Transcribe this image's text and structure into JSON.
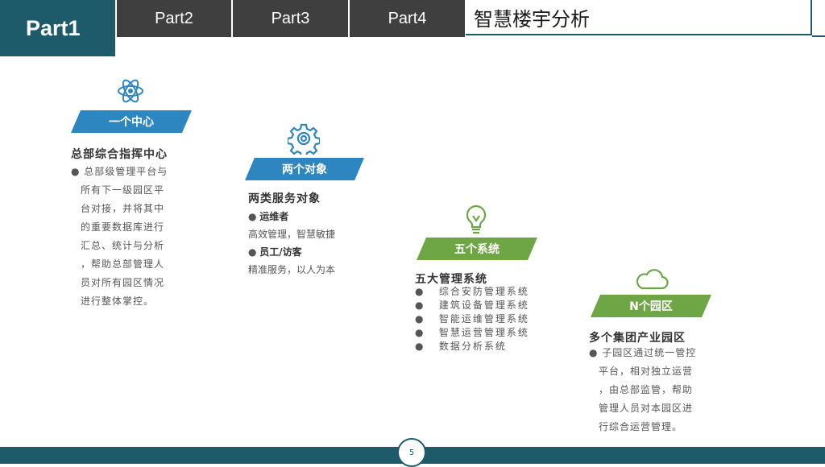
{
  "nav": {
    "active_tab": "Part1",
    "tabs": [
      "Part2",
      "Part3",
      "Part4"
    ],
    "title": "智慧楼宇分析"
  },
  "colors": {
    "teal": "#1d5b6b",
    "blue": "#2e86c1",
    "green": "#6ea646",
    "dark_tab": "#3f3f3f"
  },
  "col1": {
    "icon": "atom-icon",
    "banner": "一个中心",
    "heading": "总部综合指挥中心",
    "lines": [
      "总部级管理平台与",
      "所有下一级园区平",
      "台对接，并将其中",
      "的重要数据库进行",
      "汇总、统计与分析",
      "，帮助总部管理人",
      "员对所有园区情况",
      "进行整体掌控。"
    ]
  },
  "col2": {
    "icon": "gear-icon",
    "banner": "两个对象",
    "heading": "两类服务对象",
    "item1_title": "运维者",
    "item1_desc": "高效管理，智慧敏捷",
    "item2_title": "员工/访客",
    "item2_desc": "精准服务，以人为本"
  },
  "col3": {
    "icon": "lightbulb-icon",
    "banner": "五个系统",
    "heading": "五大管理系统",
    "items": [
      "综合安防管理系统",
      "建筑设备管理系统",
      "智能运维管理系统",
      "智慧运营管理系统",
      "数据分析系统"
    ]
  },
  "col4": {
    "icon": "cloud-icon",
    "banner": "N个园区",
    "heading": "多个集团产业园区",
    "lines": [
      "子园区通过统一管控",
      "平台，相对独立运营",
      "，由总部监管，帮助",
      "管理人员对本园区进",
      "行综合运营管理。"
    ]
  },
  "footer": {
    "page_number": "5"
  }
}
